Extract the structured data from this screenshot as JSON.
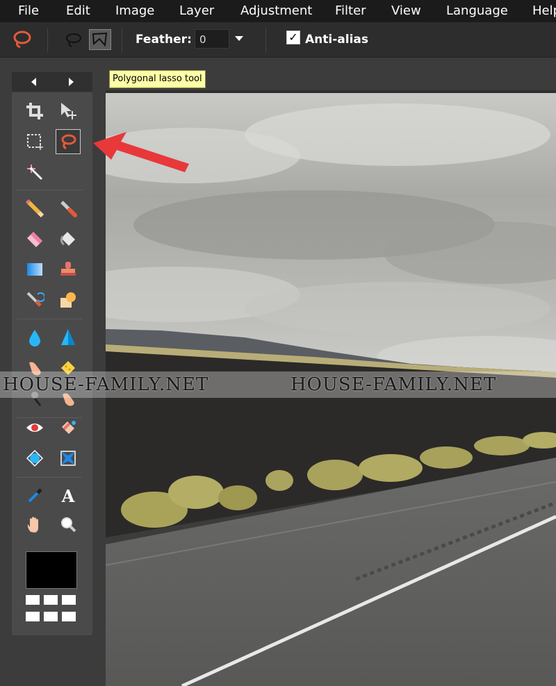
{
  "menu": [
    "File",
    "Edit",
    "Image",
    "Layer",
    "Adjustment",
    "Filter",
    "View",
    "Language",
    "Help"
  ],
  "options": {
    "feather_label": "Feather:",
    "feather_value": "0",
    "antialias_label": "Anti-alias",
    "antialias_checked": true
  },
  "tooltip": "Polygonal lasso tool",
  "watermark": [
    "HOUSE-FAMILY.NET",
    "HOUSE-FAMILY.NET"
  ],
  "colors": {
    "menubar_bg": "#1b1b1b",
    "panel_bg": "#4a4a4a",
    "arrow": "#e8383a",
    "tooltip_bg": "#ffffa8"
  },
  "tools": [
    "crop",
    "move",
    "marquee",
    "lasso",
    "magic-wand",
    "pencil",
    "brush",
    "eraser",
    "fill",
    "gradient",
    "clone-stamp",
    "color-replace",
    "shape",
    "blur",
    "sharpen",
    "smudge",
    "sponge",
    "dodge",
    "burn",
    "red-eye",
    "spot-heal",
    "bloat",
    "pinch",
    "color-picker",
    "text",
    "hand",
    "zoom"
  ]
}
